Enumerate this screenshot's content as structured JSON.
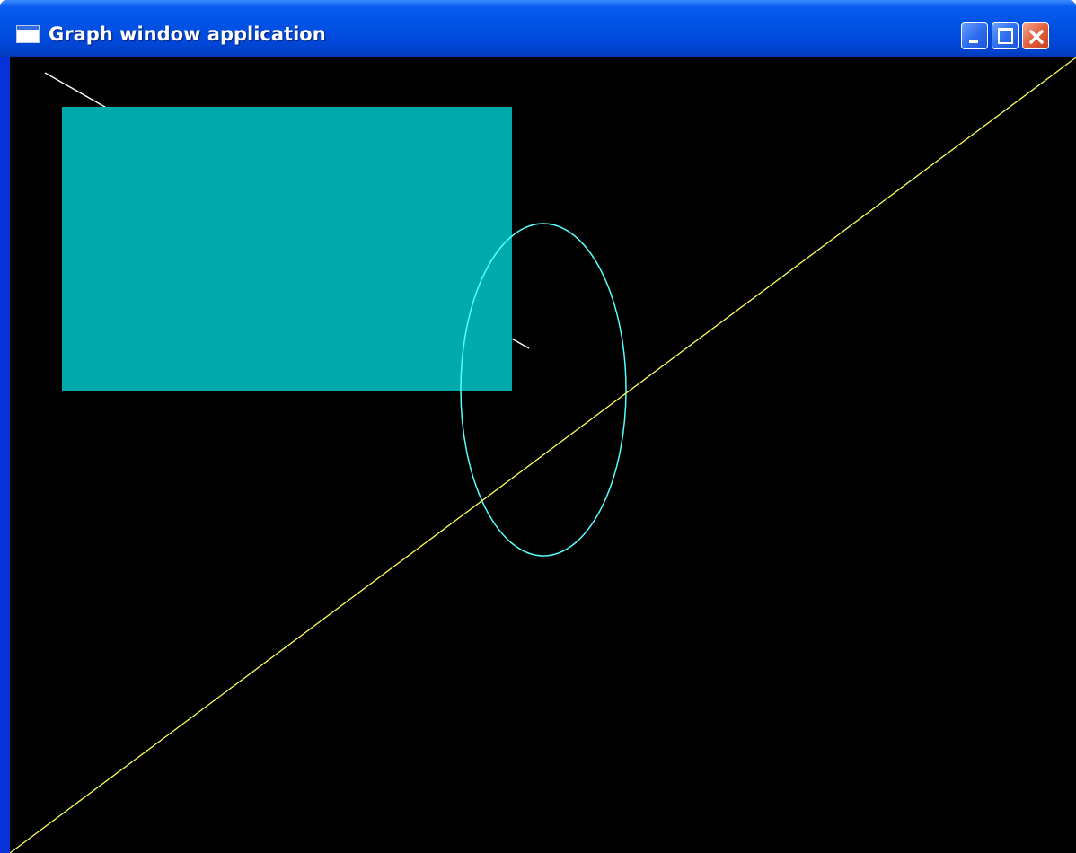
{
  "window": {
    "title": "Graph window application",
    "icon": "application-window-icon"
  },
  "titlebar_buttons": [
    {
      "name": "minimize-button",
      "icon": "minimize-icon"
    },
    {
      "name": "maximize-button",
      "icon": "maximize-icon"
    },
    {
      "name": "close-button",
      "icon": "close-icon"
    }
  ],
  "canvas": {
    "background": "#000000",
    "shapes": [
      {
        "type": "filled-rectangle",
        "color": "#00aaaa"
      },
      {
        "type": "line",
        "color": "#ffffff"
      },
      {
        "type": "ellipse-outline",
        "color": "#55ffff"
      },
      {
        "type": "line",
        "color": "#ffff55"
      }
    ]
  }
}
